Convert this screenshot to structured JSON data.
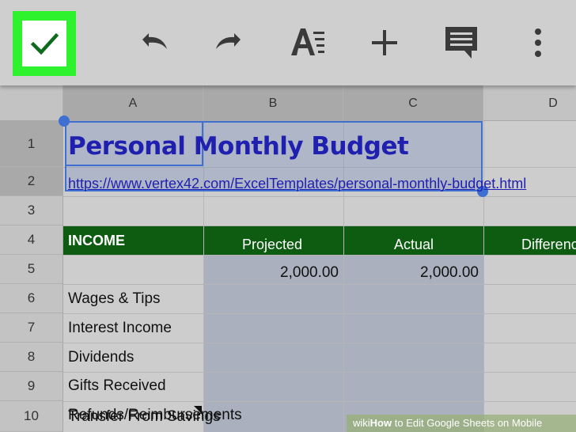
{
  "toolbar": {
    "icons": [
      "check-icon",
      "undo-icon",
      "redo-icon",
      "text-format-icon",
      "plus-icon",
      "comment-icon",
      "more-vert-icon"
    ],
    "accent": "#2ef22e"
  },
  "columns": [
    "A",
    "B",
    "C",
    "D"
  ],
  "rows": [
    "1",
    "2",
    "3",
    "4",
    "5",
    "6",
    "7",
    "8",
    "9",
    "10"
  ],
  "sheet": {
    "title": "Personal Monthly Budget",
    "link": "https://www.vertex42.com/ExcelTemplates/personal-monthly-budget.html",
    "income_label": "INCOME",
    "headers": [
      "Projected",
      "Actual",
      "Differenc"
    ],
    "items": [
      "Wages & Tips",
      "Interest Income",
      "Dividends",
      "Gifts Received",
      "Refunds/Reimbursements",
      "Transfer From Savings"
    ],
    "wages_projected": "2,000.00",
    "wages_actual": "2,000.00"
  },
  "colors": {
    "income_band": "#0d5c12",
    "selection": "#3f6fd0",
    "title_text": "#1f1fb0"
  },
  "watermark": {
    "brand": "wiki",
    "how": "How",
    "rest": " to Edit Google Sheets on Mobile"
  }
}
